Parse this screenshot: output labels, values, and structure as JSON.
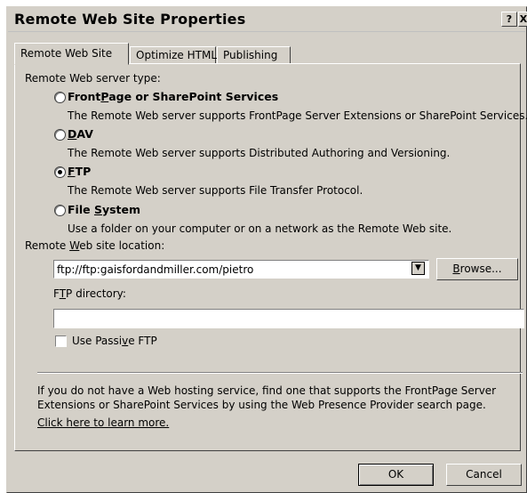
{
  "window": {
    "title": "Remote Web Site Properties",
    "help_glyph": "?",
    "close_glyph": "X"
  },
  "tabs": [
    {
      "label": "Remote Web Site",
      "active": true
    },
    {
      "label": "Optimize HTML",
      "active": false
    },
    {
      "label": "Publishing",
      "active": false
    }
  ],
  "server_type": {
    "label": "Remote Web server type:",
    "options": [
      {
        "pre": "Front",
        "key": "P",
        "post": "age or SharePoint Services",
        "description": "The Remote Web server supports FrontPage Server Extensions or SharePoint Services.",
        "selected": false
      },
      {
        "pre": "",
        "key": "D",
        "post": "AV",
        "description": "The Remote Web server supports Distributed Authoring and Versioning.",
        "selected": false
      },
      {
        "pre": "",
        "key": "F",
        "post": "TP",
        "description": "The Remote Web server supports File Transfer Protocol.",
        "selected": true
      },
      {
        "pre": "File ",
        "key": "S",
        "post": "ystem",
        "description": "Use a folder on your computer or on a network as the Remote Web site.",
        "selected": false
      }
    ]
  },
  "location": {
    "label_pre": "Remote ",
    "label_key": "W",
    "label_post": "eb site location:",
    "value": "ftp://ftp:gaisfordandmiller.com/pietro",
    "browse_pre": "",
    "browse_key": "B",
    "browse_post": "rowse..."
  },
  "ftp_directory": {
    "label_pre": "F",
    "label_key": "T",
    "label_post": "P directory:",
    "value": ""
  },
  "passive_ftp": {
    "label_pre": "Use Passi",
    "label_key": "v",
    "label_post": "e FTP",
    "checked": false
  },
  "info": {
    "line1": "If you do not have a Web hosting service, find one that supports the FrontPage Server",
    "line2": "Extensions or SharePoint Services by using the Web Presence Provider search page.",
    "link": "Click here to learn more."
  },
  "buttons": {
    "ok": "OK",
    "cancel": "Cancel"
  }
}
